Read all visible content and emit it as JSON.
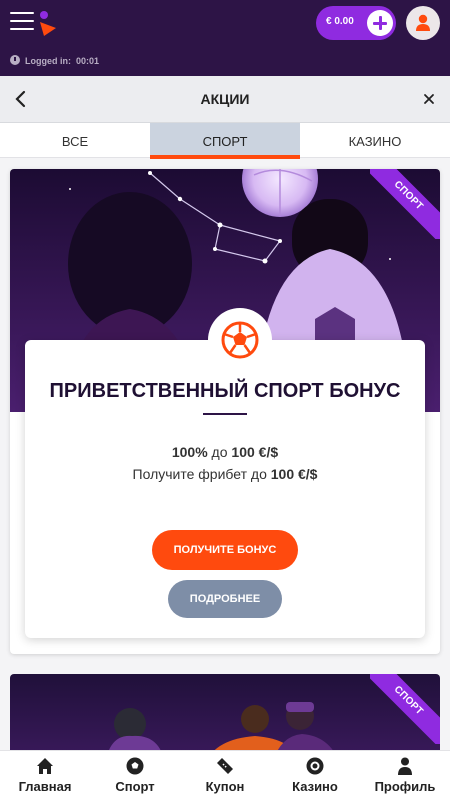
{
  "header": {
    "balance": "€ 0.00",
    "logged_in_label": "Logged in:",
    "logged_in_time": "00:01"
  },
  "titlebar": {
    "title": "АКЦИИ"
  },
  "tabs": [
    {
      "label": "ВСЕ",
      "active": false
    },
    {
      "label": "СПОРТ",
      "active": true
    },
    {
      "label": "КАЗИНО",
      "active": false
    }
  ],
  "promo": {
    "ribbon": "СПОРТ",
    "title": "ПРИВЕТСТВЕННЫЙ СПОРТ БОНУС",
    "line1_a": "100%",
    "line1_b": " до ",
    "line1_c": "100 €/$",
    "line2_a": "Получите фрибет до ",
    "line2_b": "100 €/$",
    "cta_label": "ПОЛУЧИТЕ БОНУС",
    "more_label": "ПОДРОБНЕЕ"
  },
  "promo2": {
    "ribbon": "СПОРТ"
  },
  "bottom_nav": [
    {
      "label": "Главная",
      "icon": "home-icon"
    },
    {
      "label": "Спорт",
      "icon": "soccer-ball-icon"
    },
    {
      "label": "Купон",
      "icon": "ticket-icon"
    },
    {
      "label": "Казино",
      "icon": "casino-chip-icon"
    },
    {
      "label": "Профиль",
      "icon": "user-icon"
    }
  ],
  "colors": {
    "header_bg": "#2d1446",
    "accent_purple": "#8f2be0",
    "accent_orange": "#ff4a0e",
    "secondary_button": "#7e8ea7"
  }
}
